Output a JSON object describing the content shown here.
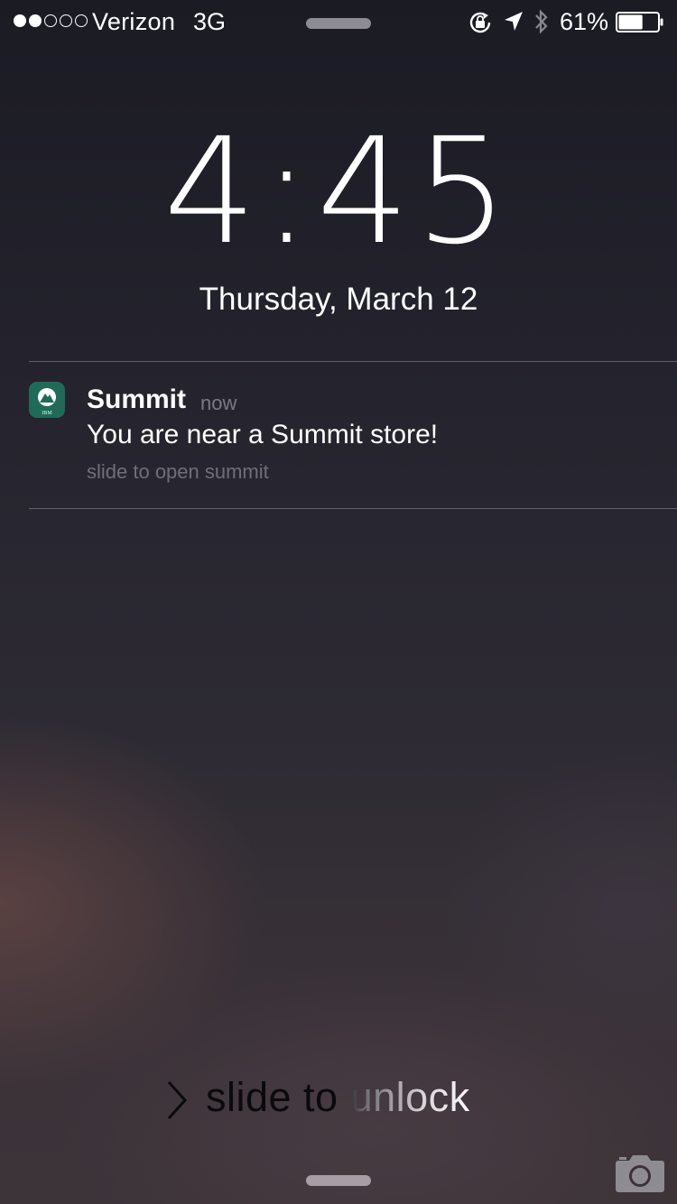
{
  "status_bar": {
    "signal_strength": 2,
    "signal_total": 5,
    "carrier": "Verizon",
    "network": "3G",
    "battery_percent": "61%",
    "battery_level": 0.61
  },
  "lock_screen": {
    "time": "4:45",
    "date": "Thursday, March 12"
  },
  "notification": {
    "app_name": "Summit",
    "time": "now",
    "message": "You are near a Summit store!",
    "action_hint": "slide to open summit",
    "app_icon_text": "IBM",
    "app_icon_color": "#1f6b57"
  },
  "bottom": {
    "unlock_label": "slide to unlock"
  },
  "icons": [
    "rotation-lock-icon",
    "location-arrow-icon",
    "bluetooth-icon",
    "battery-icon",
    "chevron-right-icon",
    "camera-icon"
  ]
}
